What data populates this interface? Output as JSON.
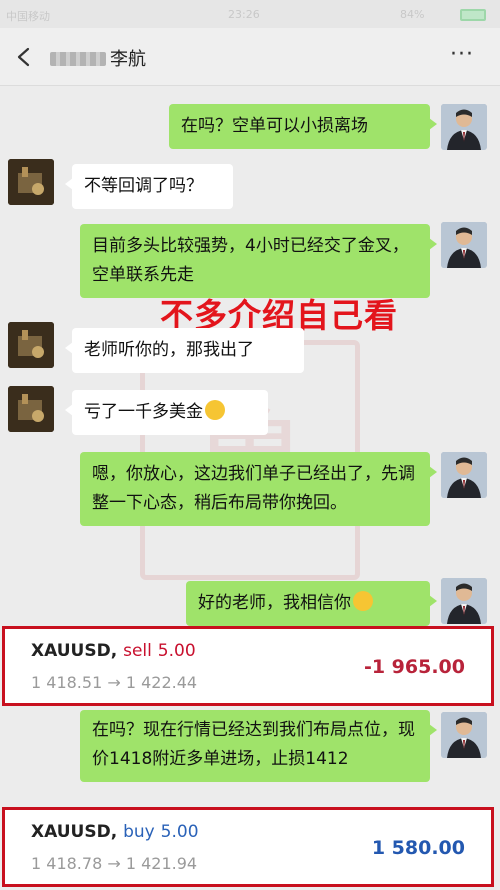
{
  "status_bar": {
    "carrier": "中国移动",
    "time": "23:26",
    "battery": "84%"
  },
  "header": {
    "contact_name": "李航",
    "more_label": "···"
  },
  "messages": [
    {
      "from": "me",
      "text": "在吗？空单可以小损离场"
    },
    {
      "from": "other",
      "text": "不等回调了吗？"
    },
    {
      "from": "me",
      "text": "目前多头比较强势，4小时已经交了金叉，空单联系先走"
    },
    {
      "from": "other",
      "text": "老师听你的，那我出了"
    },
    {
      "from": "other",
      "text": "亏了一千多美金"
    },
    {
      "from": "me",
      "text": "嗯，你放心，这边我们单子已经出了，先调整一下心态，稍后布局带你挽回。"
    },
    {
      "from": "me",
      "text": "好的老师，我相信你"
    },
    {
      "from": "me",
      "text": "在吗？现在行情已经达到我们布局点位，现价1418附近多单进场，止损1412"
    }
  ],
  "overlay_caption": "不多介绍自己看",
  "trades": [
    {
      "symbol": "XAUUSD",
      "side": "sell",
      "lots": "5.00",
      "open": "1 418.51",
      "close": "1 422.44",
      "arrow": "→",
      "pnl": "-1 965.00"
    },
    {
      "symbol": "XAUUSD",
      "side": "buy",
      "lots": "5.00",
      "open": "1 418.78",
      "close": "1 421.94",
      "arrow": "→",
      "pnl": "1 580.00"
    }
  ],
  "colors": {
    "bubble_me": "#9fe36a",
    "bubble_other": "#ffffff",
    "highlight_border": "#c8101e",
    "loss": "#b8233a",
    "profit": "#2358b0"
  }
}
